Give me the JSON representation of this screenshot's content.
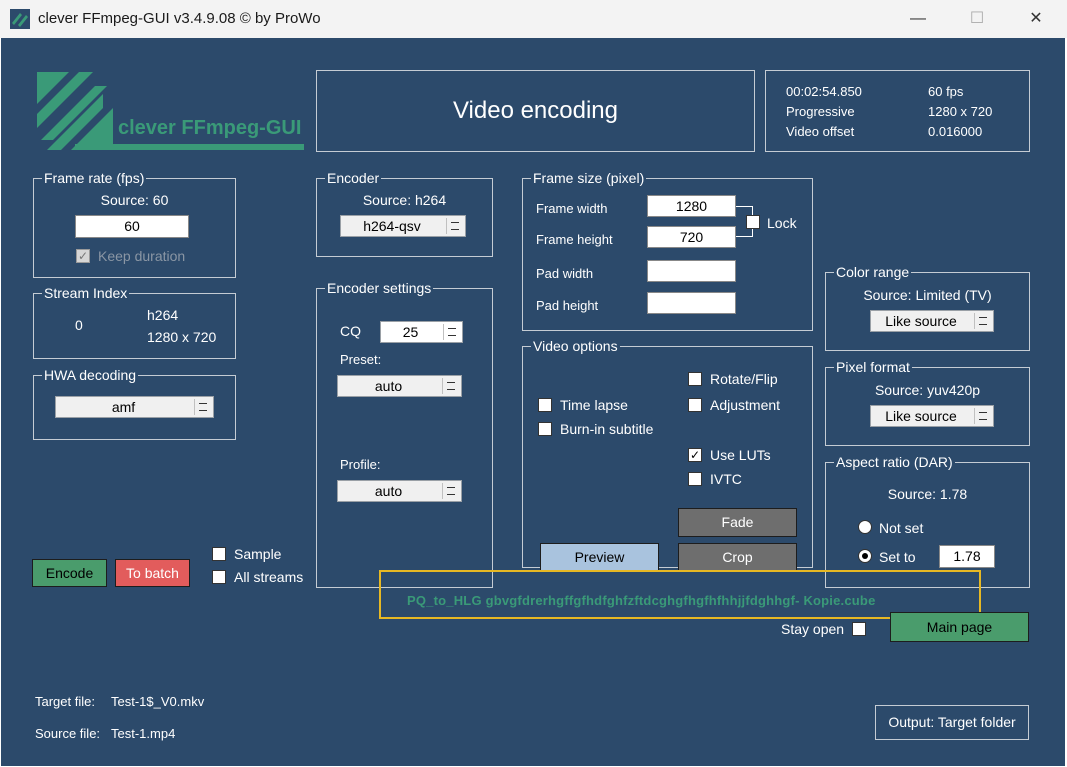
{
  "window": {
    "title": "clever FFmpeg-GUI v3.4.9.08   © by ProWo",
    "minimize_glyph": "—",
    "maximize_glyph": "☐",
    "close_glyph": "✕",
    "icon": "app-logo-icon"
  },
  "logo": {
    "text": "clever FFmpeg-GUI"
  },
  "header": {
    "title": "Video encoding"
  },
  "media_info": {
    "duration": "00:02:54.850",
    "fps": "60 fps",
    "scan": "Progressive",
    "resolution": "1280 x 720",
    "offset_label": "Video offset",
    "offset_value": "0.016000"
  },
  "frame_rate": {
    "legend": "Frame rate (fps)",
    "source": "Source: 60",
    "value": "60",
    "keep_duration": "Keep duration",
    "keep_duration_checked": true
  },
  "stream_index": {
    "legend": "Stream Index",
    "index": "0",
    "codec": "h264",
    "resolution": "1280 x 720"
  },
  "hwa": {
    "legend": "HWA decoding",
    "value": "amf"
  },
  "encoder": {
    "legend": "Encoder",
    "source": "Source: h264",
    "value": "h264-qsv"
  },
  "encoder_settings": {
    "legend": "Encoder settings",
    "cq_label": "CQ",
    "cq_value": "25",
    "preset_label": "Preset:",
    "preset_value": "auto",
    "profile_label": "Profile:",
    "profile_value": "auto"
  },
  "frame_size": {
    "legend": "Frame size (pixel)",
    "width_label": "Frame width",
    "width_value": "1280",
    "height_label": "Frame height",
    "height_value": "720",
    "lock_label": "Lock",
    "pad_width_label": "Pad width",
    "pad_height_label": "Pad height",
    "pad_width_value": "",
    "pad_height_value": ""
  },
  "video_options": {
    "legend": "Video options",
    "rotate_flip": "Rotate/Flip",
    "adjustment": "Adjustment",
    "time_lapse": "Time lapse",
    "burn_in": "Burn-in subtitle",
    "use_luts": "Use LUTs",
    "use_luts_checked": true,
    "ivtc": "IVTC",
    "fade": "Fade",
    "preview": "Preview",
    "crop": "Crop"
  },
  "color_range": {
    "legend": "Color range",
    "source": "Source: Limited (TV)",
    "value": "Like source"
  },
  "pixel_format": {
    "legend": "Pixel format",
    "source": "Source: yuv420p",
    "value": "Like source"
  },
  "aspect_ratio": {
    "legend": "Aspect ratio (DAR)",
    "source": "Source: 1.78",
    "not_set": "Not set",
    "set_to": "Set to",
    "selected": "set_to",
    "value": "1.78"
  },
  "actions": {
    "encode": "Encode",
    "to_batch": "To batch",
    "sample": "Sample",
    "all_streams": "All streams"
  },
  "lut_file": "PQ_to_HLG  gbvgfdrerhgffgfhdfghfzftdcghgfhgfhfhhjjfdghhgf- Kopie.cube",
  "stay_open": "Stay open",
  "main_page": "Main page",
  "target_file": {
    "label": "Target file:",
    "value": "Test-1$_V0.mkv"
  },
  "source_file": {
    "label": "Source file:",
    "value": "Test-1.mp4"
  },
  "output_button": "Output: Target folder",
  "colors": {
    "background": "#2c4a6b",
    "accent_green": "#3a9a78",
    "encode_button": "#4a9c6c",
    "batch_button": "#e25c5c",
    "preview_button": "#a9c3de",
    "highlight_border": "#e7b823"
  }
}
